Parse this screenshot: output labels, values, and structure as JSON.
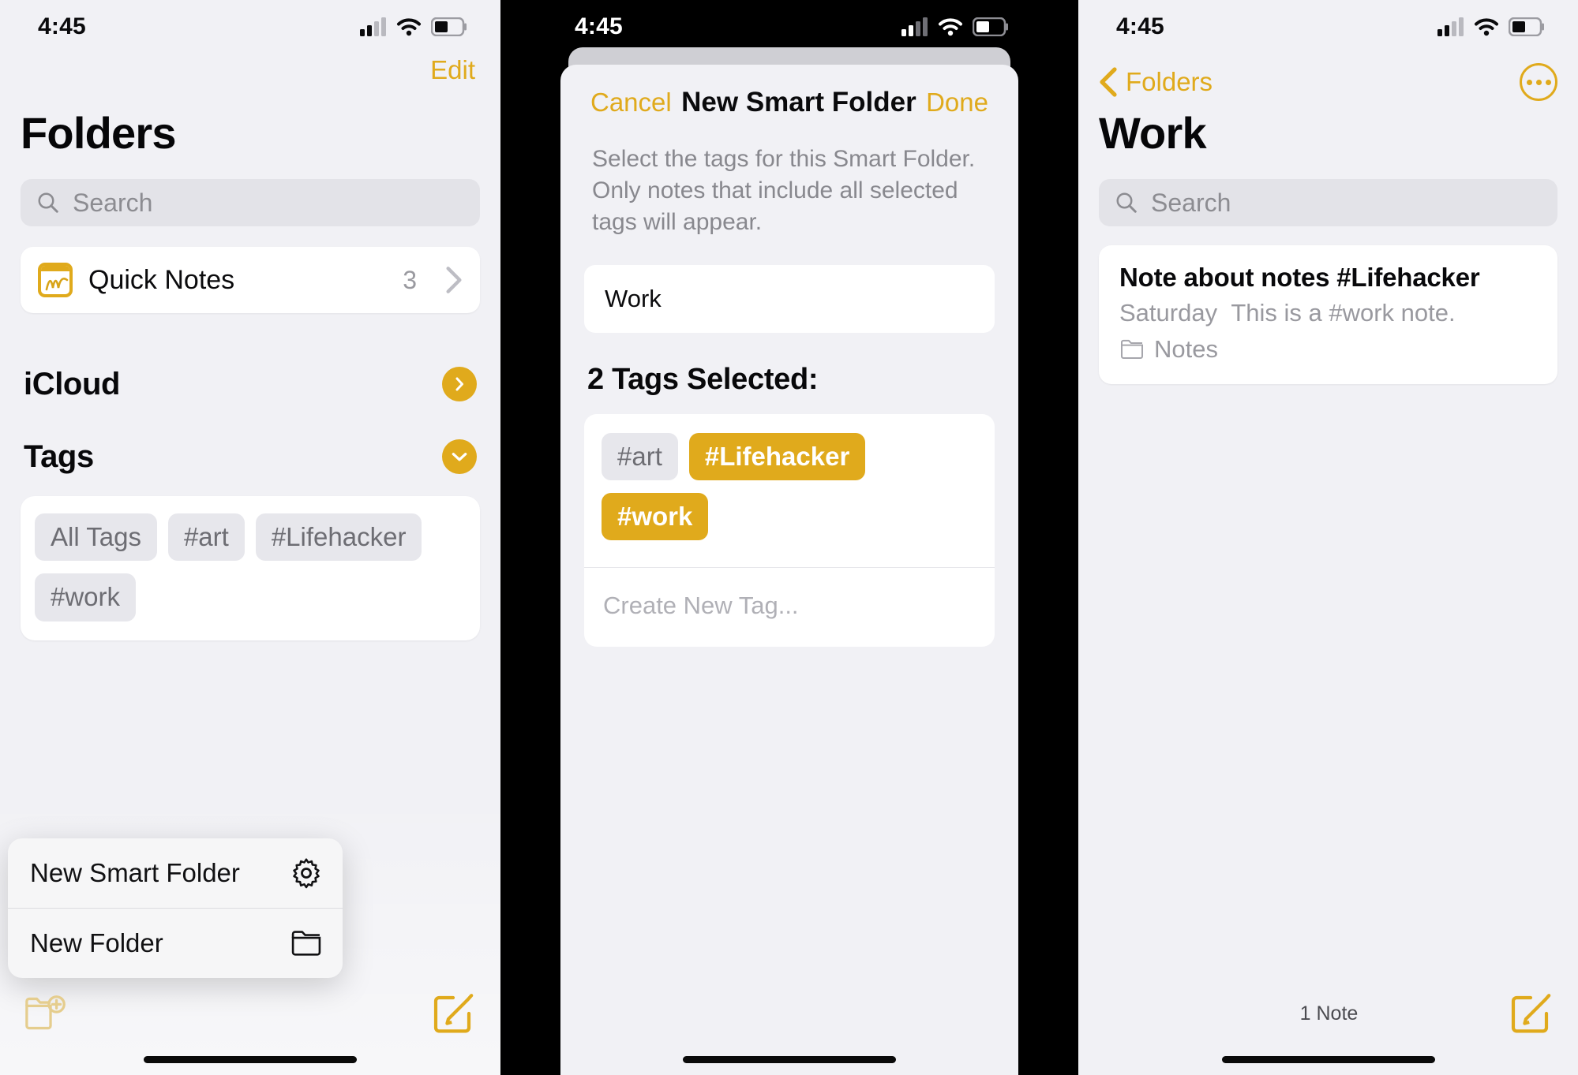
{
  "statusbar": {
    "time": "4:45"
  },
  "panel_folders": {
    "edit_label": "Edit",
    "title": "Folders",
    "search_placeholder": "Search",
    "quick_notes": {
      "label": "Quick Notes",
      "count": "3"
    },
    "icloud_label": "iCloud",
    "tags_label": "Tags",
    "tag_chips": [
      "All Tags",
      "#art",
      "#Lifehacker",
      "#work"
    ],
    "menu": [
      {
        "label": "New Smart Folder",
        "icon": "gear-icon"
      },
      {
        "label": "New Folder",
        "icon": "folder-icon"
      }
    ],
    "toolbar": {
      "new_folder_icon": "new-folder-icon",
      "compose_icon": "compose-icon"
    }
  },
  "panel_sheet": {
    "cancel_label": "Cancel",
    "title": "New Smart Folder",
    "done_label": "Done",
    "description": "Select the tags for this Smart Folder. Only notes that include all selected tags will appear.",
    "name_value": "Work",
    "tags_selected_heading": "2 Tags Selected:",
    "tags": [
      {
        "label": "#art",
        "selected": false
      },
      {
        "label": "#Lifehacker",
        "selected": true
      },
      {
        "label": "#work",
        "selected": true
      }
    ],
    "create_new_tag_placeholder": "Create New Tag..."
  },
  "panel_work": {
    "back_label": "Folders",
    "more_icon": "ellipsis-circle-icon",
    "title": "Work",
    "search_placeholder": "Search",
    "note": {
      "title": "Note about notes #Lifehacker",
      "date": "Saturday",
      "preview": "This is a #work note.",
      "folder": "Notes"
    },
    "footer_count": "1 Note",
    "compose_icon": "compose-icon"
  },
  "colors": {
    "accent": "#e0aa1c",
    "panel_bg": "#f1f1f5",
    "card_bg": "#ffffff"
  }
}
